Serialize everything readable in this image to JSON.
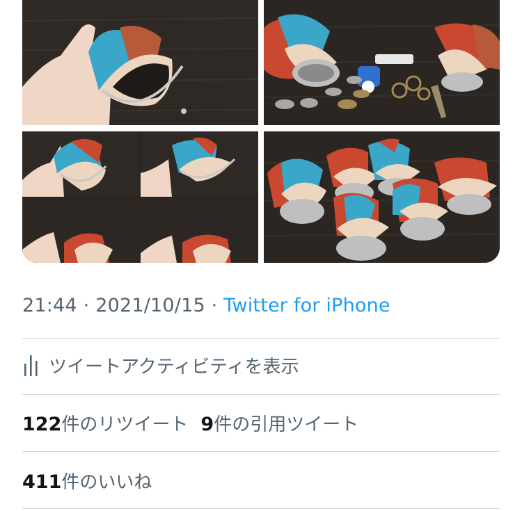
{
  "tweet": {
    "media": [
      {
        "icon": "photo-coin-purse-in-hand"
      },
      {
        "icon": "photo-coin-purses-with-keys-and-coins"
      },
      {
        "icon": "photo-collage-purse-in-hand"
      },
      {
        "icon": "photo-group-of-coin-purses"
      }
    ],
    "time": "21:44",
    "separator": "·",
    "date": "2021/10/15",
    "source": "Twitter for iPhone",
    "activity_label": "ツイートアクティビティを表示",
    "retweets": {
      "count": "122",
      "label": "件のリツイート"
    },
    "quotes": {
      "count": "9",
      "label": "件の引用ツイート"
    },
    "likes": {
      "count": "411",
      "label": "件のいいね"
    }
  },
  "colors": {
    "secondary_text": "#536471",
    "link": "#1d9bf0",
    "divider": "#cfd9de",
    "teal_leather": "#3aa6c8",
    "red_leather": "#c9482f",
    "cream_leather": "#ecd6bf"
  }
}
